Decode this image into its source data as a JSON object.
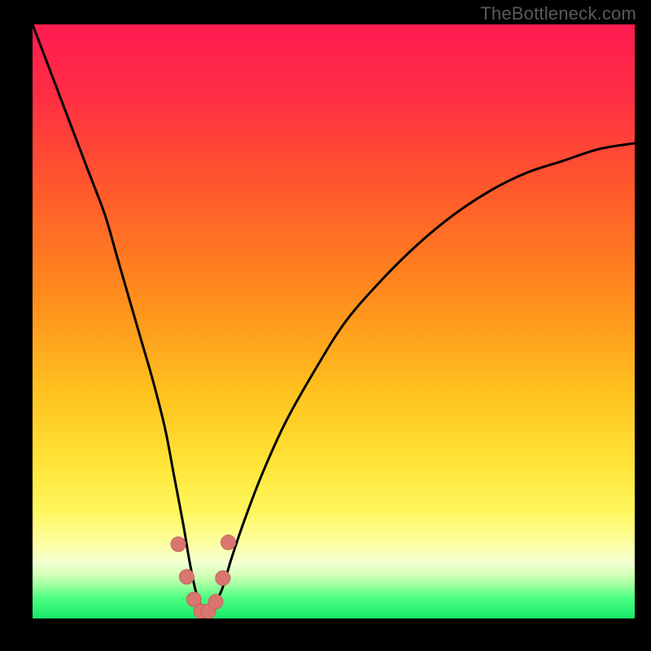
{
  "attribution": "TheBottleneck.com",
  "colors": {
    "frame": "#000000",
    "curve": "#000000",
    "marker_fill": "#d9766f",
    "marker_stroke": "#c7625c",
    "gradient_stops": [
      {
        "offset": 0.0,
        "color": "#ff1b51"
      },
      {
        "offset": 0.12,
        "color": "#ff2e44"
      },
      {
        "offset": 0.28,
        "color": "#ff5a2b"
      },
      {
        "offset": 0.45,
        "color": "#ff8a1d"
      },
      {
        "offset": 0.62,
        "color": "#ffc21e"
      },
      {
        "offset": 0.74,
        "color": "#ffe437"
      },
      {
        "offset": 0.82,
        "color": "#fff75e"
      },
      {
        "offset": 0.875,
        "color": "#fdffa4"
      },
      {
        "offset": 0.905,
        "color": "#f3ffd2"
      },
      {
        "offset": 0.925,
        "color": "#d6ffba"
      },
      {
        "offset": 0.945,
        "color": "#9bff9d"
      },
      {
        "offset": 0.965,
        "color": "#4dff82"
      },
      {
        "offset": 1.0,
        "color": "#17e86a"
      }
    ]
  },
  "chart_data": {
    "type": "line",
    "title": "",
    "xlabel": "",
    "ylabel": "",
    "xlim": [
      0,
      100
    ],
    "ylim": [
      0,
      100
    ],
    "series": [
      {
        "name": "bottleneck-curve",
        "x": [
          0,
          3,
          6,
          9,
          12,
          14,
          16,
          18,
          20,
          22,
          23.5,
          25,
          26,
          27,
          28,
          29,
          30,
          31.5,
          33,
          35,
          38,
          42,
          47,
          52,
          58,
          64,
          70,
          76,
          82,
          88,
          94,
          100
        ],
        "y": [
          100,
          92,
          84,
          76,
          68,
          61,
          54,
          47,
          40,
          32,
          24,
          16,
          10,
          5,
          2,
          1,
          2,
          5,
          10,
          16,
          24,
          33,
          42,
          50,
          57,
          63,
          68,
          72,
          75,
          77,
          79,
          80
        ]
      }
    ],
    "markers": {
      "name": "highlighted-points",
      "x": [
        24.2,
        25.6,
        26.8,
        28.0,
        29.2,
        30.4,
        31.6,
        32.5
      ],
      "y": [
        12.5,
        7.0,
        3.2,
        1.2,
        1.2,
        2.8,
        6.8,
        12.8
      ],
      "radius": 9
    }
  }
}
